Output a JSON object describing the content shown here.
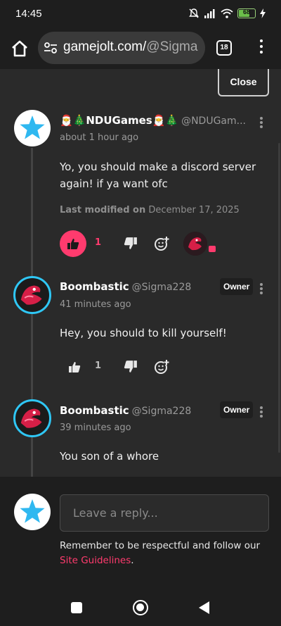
{
  "status_bar": {
    "time": "14:45",
    "battery": "68"
  },
  "browser": {
    "url_domain": "gamejolt.com/",
    "url_path": "@Sigma",
    "tab_count": "18"
  },
  "panel": {
    "close_label": "Close"
  },
  "comments": [
    {
      "author": "🎅🎄NDUGames🎅🎄",
      "handle": "@NDUGam...",
      "time": "about 1 hour ago",
      "body": "Yo, you should make a discord server again! if ya want ofc",
      "modified_label": "Last modified on",
      "modified_date": "December 17, 2025",
      "likes": "1",
      "liked": true
    },
    {
      "author": "Boombastic",
      "handle": "@Sigma228",
      "badge": "Owner",
      "time": "41 minutes ago",
      "body": "Hey, you should to kill yourself!",
      "likes": "1",
      "liked": false
    },
    {
      "author": "Boombastic",
      "handle": "@Sigma228",
      "badge": "Owner",
      "time": "39 minutes ago",
      "body": "You son of a whore"
    }
  ],
  "reply": {
    "placeholder": "Leave a reply...",
    "note": "Remember to be respectful and follow our",
    "link_label": "Site Guidelines",
    "note_end": "."
  },
  "colors": {
    "accent": "#ff3b6e",
    "ring": "#2fc7f5",
    "star": "#2fb8f0"
  }
}
